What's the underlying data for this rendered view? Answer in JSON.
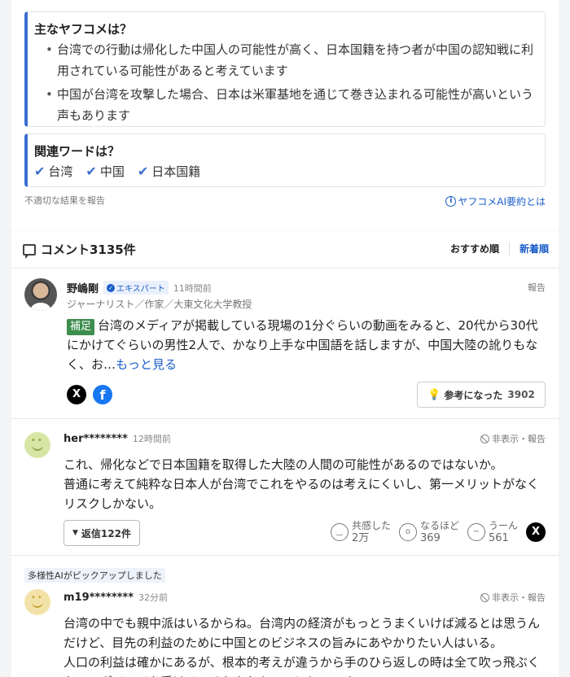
{
  "summary": {
    "heading": "主なヤフコメは？",
    "points": [
      "台湾での行動は帰化した中国人の可能性が高く、日本国籍を持つ者が中国の認知戦に利用されている可能性があると考えています",
      "中国が台湾を攻撃した場合、日本は米軍基地を通じて巻き込まれる可能性が高いという声もあります"
    ],
    "related_heading": "関連ワードは？",
    "related_words": [
      "台湾",
      "中国",
      "日本国籍"
    ],
    "report_text": "不適切な結果を報告",
    "about_ai": "ヤフコメAI要約とは"
  },
  "comments_section": {
    "title": "コメント3135件",
    "sort_recommended": "おすすめ順",
    "sort_newest": "新着順"
  },
  "comments": [
    {
      "author": "野嶋剛",
      "badge": "エキスパート",
      "time": "11時間前",
      "profile": "ジャーナリスト／作家／大東文化大学教授",
      "report": "報告",
      "tag": "補足",
      "text": "台湾のメディアが掲載している現場の1分ぐらいの動画をみると、20代から30代にかけてぐらいの男性2人で、かなり上手な中国語を話しますが、中国大陸の訛りもなく、お…",
      "more": "もっと見る",
      "helpful_label": "参考になった",
      "helpful_count": "3902",
      "x_label": "X",
      "fb_label": "f"
    },
    {
      "author": "her********",
      "time": "12時間前",
      "actions": "非表示・報告",
      "text": "これ、帰化などで日本国籍を取得した大陸の人間の可能性があるのではないか。\n普通に考えて純粋な日本人が台湾でこれをやるのは考えにくいし、第一メリットがなくリスクしかない。",
      "reply_label": "返信122件",
      "reactions": [
        {
          "label": "共感した",
          "count": "2万"
        },
        {
          "label": "なるほど",
          "count": "369"
        },
        {
          "label": "うーん",
          "count": "561"
        }
      ]
    },
    {
      "pickup": "多様性AIがピックアップしました",
      "author": "m19********",
      "time": "32分前",
      "actions": "非表示・報告",
      "text": "台湾の中でも親中派はいるからね。台湾内の経済がもっとうまくいけば減るとは思うんだけど、目先の利益のために中国とのビジネスの旨みにあやかりたい人はいる。\n人口の利益は確かにあるが、根本的考えが違うから手のひら返しの時は全て吹っ飛ぶくらいのダメージを受ける。それをわかってほしいです。"
    }
  ]
}
